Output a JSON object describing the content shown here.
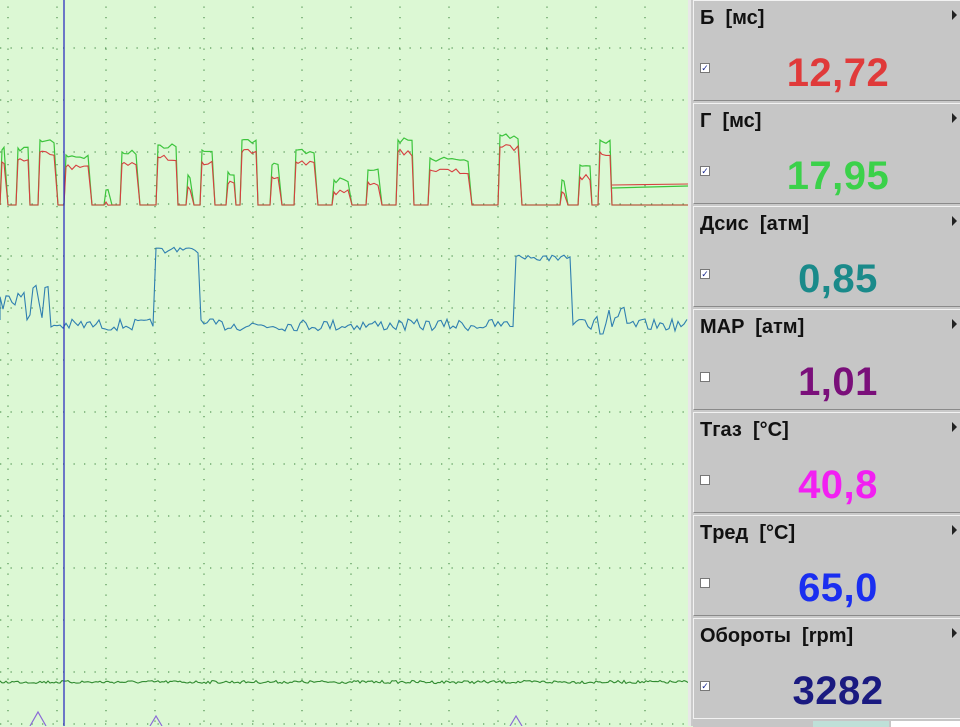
{
  "channels": [
    {
      "name": "Б  [мс]",
      "value": "12,72",
      "color": "#e03a3a",
      "checked": true
    },
    {
      "name": "Г  [мс]",
      "value": "17,95",
      "color": "#3bd14a",
      "checked": true
    },
    {
      "name": "Дсис  [атм]",
      "value": "0,85",
      "color": "#1a8a8a",
      "checked": true
    },
    {
      "name": "MAP  [атм]",
      "value": "1,01",
      "color": "#7a0f7a",
      "checked": false
    },
    {
      "name": "Tгаз  [°C]",
      "value": "40,8",
      "color": "#f21ff2",
      "checked": false
    },
    {
      "name": "Tред  [°C]",
      "value": "65,0",
      "color": "#1a2ef0",
      "checked": false
    },
    {
      "name": "Обороты  [rpm]",
      "value": "3282",
      "color": "#1a1a80",
      "checked": true
    }
  ],
  "colors": {
    "grid_dot": "#5a9a5a",
    "cursor": "#3030c0",
    "trace_red": "#d64040",
    "trace_green": "#3cc43c",
    "trace_blue": "#2f7fb0",
    "trace_dark_green": "#2f8a2f",
    "trace_violet": "#8a6ad6"
  },
  "icons": {
    "channel_menu": "triangle-right-icon",
    "channel_checkbox": "checkbox-icon"
  }
}
